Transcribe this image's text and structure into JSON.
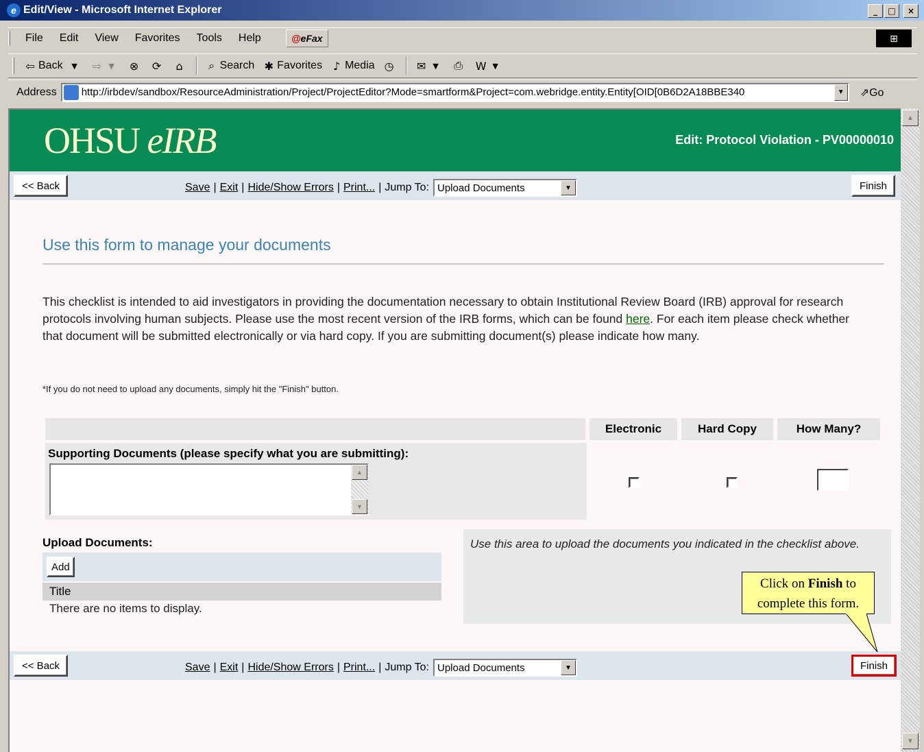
{
  "window": {
    "title": "Edit/View - Microsoft Internet Explorer",
    "controls": [
      "_",
      "□",
      "×"
    ]
  },
  "menu": [
    "File",
    "Edit",
    "View",
    "Favorites",
    "Tools",
    "Help"
  ],
  "efax_label": "eFax",
  "toolbar": {
    "back": "Back",
    "search": "Search",
    "favorites": "Favorites",
    "media": "Media"
  },
  "address": {
    "label": "Address",
    "url": "http://irbdev/sandbox/ResourceAdministration/Project/ProjectEditor?Mode=smartform&Project=com.webridge.entity.Entity[OID[0B6D2A18BBE340",
    "go": "Go"
  },
  "banner": {
    "logo_main": "OHSU ",
    "logo_italic": "eIRB",
    "title": "Edit: Protocol Violation - PV00000010"
  },
  "nav": {
    "back": "<< Back",
    "save": "Save",
    "exit": "Exit",
    "hide_show": "Hide/Show Errors",
    "print": "Print...",
    "jump_to": "Jump To:",
    "jump_value": "Upload Documents",
    "finish": "Finish"
  },
  "form": {
    "heading": "Use this form to manage your documents",
    "intro_before": "This checklist is intended to aid investigators in providing the documentation necessary to obtain Institutional Review Board (IRB) approval for research protocols involving human subjects.  Please use the most recent version of the IRB forms, which can be found ",
    "intro_link": "here",
    "intro_after": ".  For each item please check whether that document will be submitted electronically or via hard copy.  If you are submitting document(s) please indicate how many.",
    "note": "*If you do not need to upload any documents, simply hit the \"Finish\" button.",
    "col_electronic": "Electronic",
    "col_hard_copy": "Hard Copy",
    "col_how_many": "How Many?",
    "supporting_label": "Supporting Documents (please specify what you are submitting):",
    "supporting_value": "",
    "upload_label": "Upload Documents:",
    "add": "Add",
    "title_col": "Title",
    "no_items": "There are no items to display.",
    "help_text": "Use this area to upload the documents you indicated in the checklist above."
  },
  "callout": {
    "before": "Click on ",
    "bold": "Finish",
    "after": " to complete this form."
  }
}
